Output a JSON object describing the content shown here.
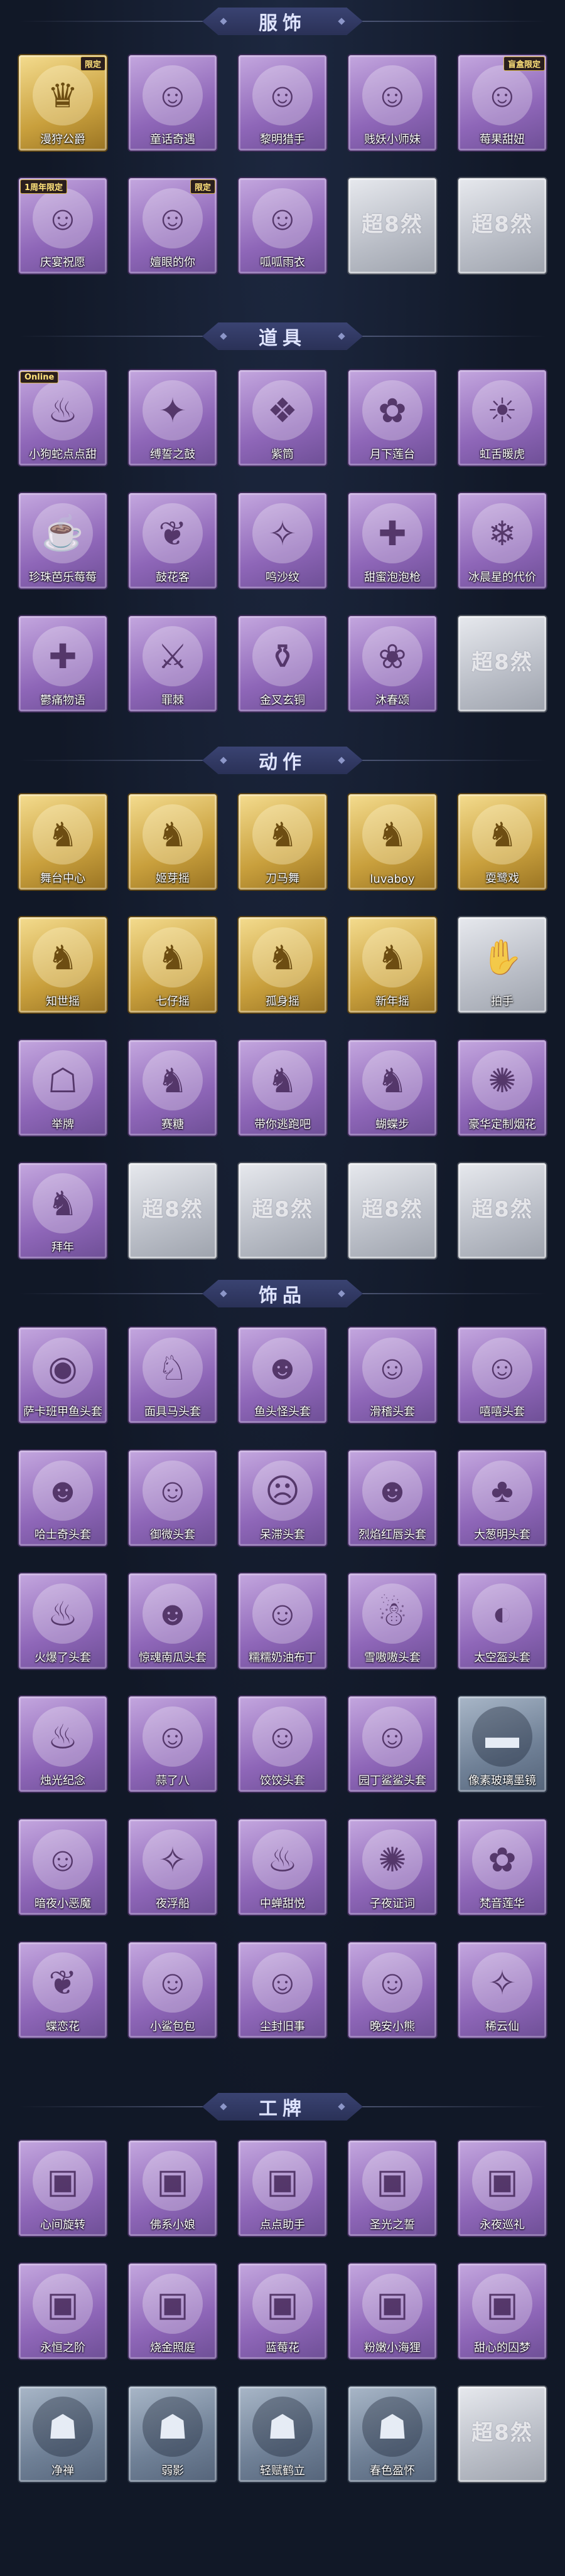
{
  "sections": [
    {
      "title": "服饰",
      "items": [
        {
          "name": "漫狩公爵",
          "style": "gold",
          "icon": "character-portrait-icon",
          "glyph": "♛",
          "badge": "限定"
        },
        {
          "name": "童话奇遇",
          "style": "purple",
          "icon": "character-portrait-icon",
          "glyph": "☺"
        },
        {
          "name": "黎明猎手",
          "style": "purple",
          "icon": "character-portrait-icon",
          "glyph": "☺"
        },
        {
          "name": "贱妖小师妹",
          "style": "purple",
          "icon": "character-portrait-icon",
          "glyph": "☺"
        },
        {
          "name": "莓果甜妞",
          "style": "purple",
          "icon": "character-portrait-icon",
          "glyph": "☺",
          "badge": "盲盒限定"
        },
        {
          "name": "庆宴祝愿",
          "style": "purple",
          "icon": "character-portrait-icon",
          "glyph": "☺",
          "badge": "1周年限定",
          "badge_left": true
        },
        {
          "name": "嬗眼的你",
          "style": "purple",
          "icon": "character-portrait-icon",
          "glyph": "☺",
          "badge": "限定"
        },
        {
          "name": "呱呱雨衣",
          "style": "purple",
          "icon": "character-portrait-icon",
          "glyph": "☺"
        },
        {
          "name": "",
          "style": "silver",
          "icon": "placeholder-logo-icon",
          "watermark": "超8然"
        },
        {
          "name": "",
          "style": "silver",
          "icon": "placeholder-logo-icon",
          "watermark": "超8然"
        }
      ]
    },
    {
      "title": "道具",
      "items": [
        {
          "name": "小狗蛇点点甜",
          "style": "purple",
          "icon": "prop-icon",
          "glyph": "♨",
          "badge": "Online",
          "badge_left": true
        },
        {
          "name": "缚誓之鼓",
          "style": "purple",
          "icon": "prop-icon",
          "glyph": "✦"
        },
        {
          "name": "紫筒",
          "style": "purple",
          "icon": "prop-icon",
          "glyph": "❖"
        },
        {
          "name": "月下莲台",
          "style": "purple",
          "icon": "prop-icon",
          "glyph": "✿"
        },
        {
          "name": "虹舌暖虎",
          "style": "purple",
          "icon": "prop-icon",
          "glyph": "☀"
        },
        {
          "name": "珍珠芭乐莓莓",
          "style": "purple",
          "icon": "prop-icon",
          "glyph": "☕"
        },
        {
          "name": "鼓花客",
          "style": "purple",
          "icon": "prop-icon",
          "glyph": "❦"
        },
        {
          "name": "鸣沙纹",
          "style": "purple",
          "icon": "prop-icon",
          "glyph": "✧"
        },
        {
          "name": "甜蜜泡泡枪",
          "style": "purple",
          "icon": "prop-icon",
          "glyph": "✚"
        },
        {
          "name": "冰晨星的代价",
          "style": "purple",
          "icon": "prop-icon",
          "glyph": "❄"
        },
        {
          "name": "鬱痛物语",
          "style": "purple",
          "icon": "prop-icon",
          "glyph": "✚"
        },
        {
          "name": "罪棘",
          "style": "purple",
          "icon": "prop-icon",
          "glyph": "⚔"
        },
        {
          "name": "金叉玄铜",
          "style": "purple",
          "icon": "prop-icon",
          "glyph": "⚱"
        },
        {
          "name": "沐春颂",
          "style": "purple",
          "icon": "prop-icon",
          "glyph": "❀"
        },
        {
          "name": "",
          "style": "silver",
          "icon": "placeholder-logo-icon",
          "watermark": "超8然"
        }
      ]
    },
    {
      "title": "动作",
      "items": [
        {
          "name": "舞台中心",
          "style": "gold",
          "icon": "emote-pose-icon",
          "glyph": "♞"
        },
        {
          "name": "姬芽摇",
          "style": "gold",
          "icon": "emote-pose-icon",
          "glyph": "♞"
        },
        {
          "name": "刀马舞",
          "style": "gold",
          "icon": "emote-pose-icon",
          "glyph": "♞"
        },
        {
          "name": "luvaboy",
          "style": "gold",
          "icon": "emote-pose-icon",
          "glyph": "♞"
        },
        {
          "name": "耍鹭戏",
          "style": "gold",
          "icon": "emote-pose-icon",
          "glyph": "♞"
        },
        {
          "name": "知世摇",
          "style": "gold",
          "icon": "emote-pose-icon",
          "glyph": "♞"
        },
        {
          "name": "七仔摇",
          "style": "gold",
          "icon": "emote-pose-icon",
          "glyph": "♞"
        },
        {
          "name": "孤身摇",
          "style": "gold",
          "icon": "emote-pose-icon",
          "glyph": "♞"
        },
        {
          "name": "新年摇",
          "style": "gold",
          "icon": "emote-pose-icon",
          "glyph": "♞"
        },
        {
          "name": "拍手",
          "style": "silver",
          "icon": "emote-pose-icon",
          "glyph": "✋"
        },
        {
          "name": "举牌",
          "style": "purple",
          "icon": "emote-pose-icon",
          "glyph": "☖"
        },
        {
          "name": "赛糖",
          "style": "purple",
          "icon": "emote-pose-icon",
          "glyph": "♞"
        },
        {
          "name": "带你逃跑吧",
          "style": "purple",
          "icon": "emote-pose-icon",
          "glyph": "♞"
        },
        {
          "name": "蝴蝶步",
          "style": "purple",
          "icon": "emote-pose-icon",
          "glyph": "♞"
        },
        {
          "name": "豪华定制烟花",
          "style": "purple",
          "icon": "emote-pose-icon",
          "glyph": "✺"
        },
        {
          "name": "拜年",
          "style": "purple",
          "icon": "emote-pose-icon",
          "glyph": "♞"
        },
        {
          "name": "",
          "style": "silver",
          "icon": "placeholder-logo-icon",
          "watermark": "超8然"
        },
        {
          "name": "",
          "style": "silver",
          "icon": "placeholder-logo-icon",
          "watermark": "超8然"
        },
        {
          "name": "",
          "style": "silver",
          "icon": "placeholder-logo-icon",
          "watermark": "超8然"
        },
        {
          "name": "",
          "style": "silver",
          "icon": "placeholder-logo-icon",
          "watermark": "超8然"
        }
      ]
    },
    {
      "title": "饰品",
      "items": [
        {
          "name": "萨卡班甲鱼头套",
          "style": "purple",
          "icon": "head-accessory-icon",
          "glyph": "◉"
        },
        {
          "name": "面具马头套",
          "style": "purple",
          "icon": "head-accessory-icon",
          "glyph": "♘"
        },
        {
          "name": "鱼头怪头套",
          "style": "purple",
          "icon": "head-accessory-icon",
          "glyph": "☻"
        },
        {
          "name": "滑稽头套",
          "style": "purple",
          "icon": "head-accessory-icon",
          "glyph": "☺"
        },
        {
          "name": "嘻嘻头套",
          "style": "purple",
          "icon": "head-accessory-icon",
          "glyph": "☺"
        },
        {
          "name": "哈士奇头套",
          "style": "purple",
          "icon": "head-accessory-icon",
          "glyph": "☻"
        },
        {
          "name": "御微头套",
          "style": "purple",
          "icon": "head-accessory-icon",
          "glyph": "☺"
        },
        {
          "name": "呆滞头套",
          "style": "purple",
          "icon": "head-accessory-icon",
          "glyph": "☹"
        },
        {
          "name": "烈焰红唇头套",
          "style": "purple",
          "icon": "head-accessory-icon",
          "glyph": "☻"
        },
        {
          "name": "大葱明头套",
          "style": "purple",
          "icon": "head-accessory-icon",
          "glyph": "♣"
        },
        {
          "name": "火爆了头套",
          "style": "purple",
          "icon": "head-accessory-icon",
          "glyph": "♨"
        },
        {
          "name": "惊魂南瓜头套",
          "style": "purple",
          "icon": "head-accessory-icon",
          "glyph": "☻"
        },
        {
          "name": "糯糯奶油布丁",
          "style": "purple",
          "icon": "head-accessory-icon",
          "glyph": "☺"
        },
        {
          "name": "雪嗷嗷头套",
          "style": "purple",
          "icon": "head-accessory-icon",
          "glyph": "☃"
        },
        {
          "name": "太空盔头套",
          "style": "purple",
          "icon": "head-accessory-icon",
          "glyph": "◐"
        },
        {
          "name": "烛光纪念",
          "style": "purple",
          "icon": "head-accessory-icon",
          "glyph": "♨"
        },
        {
          "name": "蒜了八",
          "style": "purple",
          "icon": "head-accessory-icon",
          "glyph": "☺"
        },
        {
          "name": "饺饺头套",
          "style": "purple",
          "icon": "head-accessory-icon",
          "glyph": "☺"
        },
        {
          "name": "园丁鲨鲨头套",
          "style": "purple",
          "icon": "head-accessory-icon",
          "glyph": "☺"
        },
        {
          "name": "像素玻璃墨镜",
          "style": "slate",
          "icon": "head-accessory-icon",
          "glyph": "▬"
        },
        {
          "name": "暗夜小恶魔",
          "style": "purple",
          "icon": "head-accessory-icon",
          "glyph": "☺"
        },
        {
          "name": "夜浮船",
          "style": "purple",
          "icon": "head-accessory-icon",
          "glyph": "✧"
        },
        {
          "name": "中蝉甜悦",
          "style": "purple",
          "icon": "head-accessory-icon",
          "glyph": "♨"
        },
        {
          "name": "子夜证词",
          "style": "purple",
          "icon": "head-accessory-icon",
          "glyph": "✺"
        },
        {
          "name": "梵音莲华",
          "style": "purple",
          "icon": "head-accessory-icon",
          "glyph": "✿"
        },
        {
          "name": "蝶恋花",
          "style": "purple",
          "icon": "head-accessory-icon",
          "glyph": "❦"
        },
        {
          "name": "小鲨包包",
          "style": "purple",
          "icon": "head-accessory-icon",
          "glyph": "☺"
        },
        {
          "name": "尘封旧事",
          "style": "purple",
          "icon": "head-accessory-icon",
          "glyph": "☺"
        },
        {
          "name": "晚安小熊",
          "style": "purple",
          "icon": "head-accessory-icon",
          "glyph": "☺"
        },
        {
          "name": "稀云仙",
          "style": "purple",
          "icon": "head-accessory-icon",
          "glyph": "✧"
        }
      ]
    },
    {
      "title": "工牌",
      "items": [
        {
          "name": "心间旋转",
          "style": "purple",
          "icon": "badge-card-icon",
          "glyph": "▣"
        },
        {
          "name": "佛系小娘",
          "style": "purple",
          "icon": "badge-card-icon",
          "glyph": "▣"
        },
        {
          "name": "点点助手",
          "style": "purple",
          "icon": "badge-card-icon",
          "glyph": "▣"
        },
        {
          "name": "圣光之誓",
          "style": "purple",
          "icon": "badge-card-icon",
          "glyph": "▣"
        },
        {
          "name": "永夜巡礼",
          "style": "purple",
          "icon": "badge-card-icon",
          "glyph": "▣"
        },
        {
          "name": "永恒之阶",
          "style": "purple",
          "icon": "badge-card-icon",
          "glyph": "▣"
        },
        {
          "name": "烧金照庭",
          "style": "purple",
          "icon": "badge-card-icon",
          "glyph": "▣"
        },
        {
          "name": "蓝莓花",
          "style": "purple",
          "icon": "badge-card-icon",
          "glyph": "▣"
        },
        {
          "name": "粉嫩小海狸",
          "style": "purple",
          "icon": "badge-card-icon",
          "glyph": "▣"
        },
        {
          "name": "甜心的囚梦",
          "style": "purple",
          "icon": "badge-card-icon",
          "glyph": "▣"
        },
        {
          "name": "净禅",
          "style": "slate",
          "icon": "badge-card-icon",
          "glyph": "☗"
        },
        {
          "name": "弱影",
          "style": "slate",
          "icon": "badge-card-icon",
          "glyph": "☗"
        },
        {
          "name": "轻赋鹤立",
          "style": "slate",
          "icon": "badge-card-icon",
          "glyph": "☗"
        },
        {
          "name": "春色盈怀",
          "style": "slate",
          "icon": "badge-card-icon",
          "glyph": "☗"
        },
        {
          "name": "",
          "style": "silver",
          "icon": "placeholder-logo-icon",
          "watermark": "超8然"
        }
      ]
    }
  ]
}
